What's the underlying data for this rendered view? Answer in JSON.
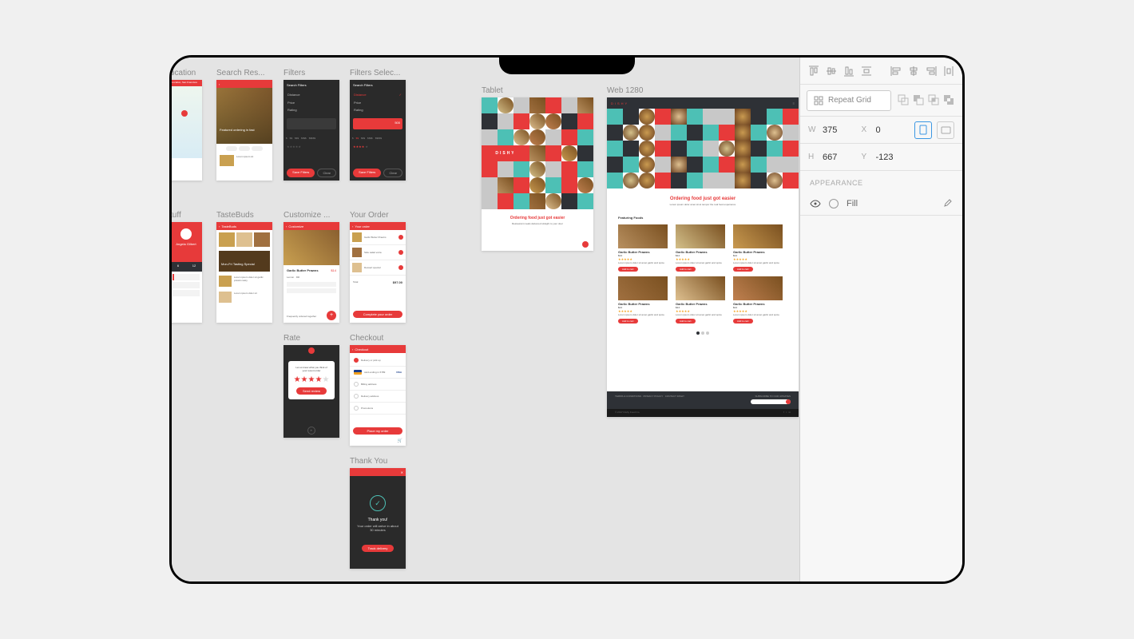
{
  "panel": {
    "repeat_label": "Repeat Grid",
    "w_label": "W",
    "w_value": "375",
    "h_label": "H",
    "h_value": "667",
    "x_label": "X",
    "x_value": "0",
    "y_label": "Y",
    "y_value": "-123",
    "appearance_head": "APPEARANCE",
    "fill_label": "Fill"
  },
  "mobile": {
    "row1": [
      "ocation",
      "Search Res...",
      "Filters",
      "Filters Selec..."
    ],
    "row2": [
      "tuff",
      "TasteBuds",
      "Customize ...",
      "Your Order"
    ],
    "row3": [
      "Rate",
      "Checkout"
    ],
    "row4": [
      "Thank You"
    ],
    "save_btn": "Save Filters",
    "clear_btn": "Clear",
    "filter_opts": [
      "Price",
      "Rating"
    ],
    "filter_opt_top": "Distance",
    "loc_text": "Location, San Francisco",
    "dish_title": "Garlic Butter Prawns",
    "dish_price": "$14",
    "complete_btn": "Complete your order",
    "order_total_label": "Total",
    "order_total": "$97.00",
    "rate_text": "Let us know what you think of your recent order",
    "rate_btn": "Send review",
    "thank_title": "Thank you!",
    "thank_body": "Your order will arrive in about 30 minutes",
    "thank_btn": "Track delivery",
    "checkout_head": "Checkout",
    "checkout_opts": [
      "Delivery or pick up",
      "card ending in 6789",
      "Billing address",
      "Delivery address",
      "Promotions"
    ],
    "checkout_btn": "Place my order",
    "tastebuds_head": "TasteBuds",
    "customize_head": "Customize",
    "yourorder_head": "Your order"
  },
  "tablet": {
    "label": "Tablet",
    "logo": "DISHY",
    "headline": "Ordering food just got easier",
    "sub": "Restaurant meals delivered straight to your door"
  },
  "web": {
    "label": "Web 1280",
    "logo": "DISHY",
    "headline": "Ordering food just got easier",
    "sub": "Lorem ipsum dolor amet sit at tempor the real food experience",
    "section": "Featuring Foods",
    "item_title": "Garlic Butter Prawns",
    "item_price": "$14",
    "item_btn": "Add to cart",
    "stars": "★★★★★",
    "footer1": "TERMS & CONDITIONS",
    "footer2": "PRIVACY POLICY",
    "footer3": "CONTACT DISHY",
    "footer_sub": "SUBSCRIBE TO OUR UPDATES"
  },
  "grid_colors": [
    "#4dc0b5",
    "#e73a3a",
    "#c8c8c8",
    "#2e3136",
    "#e73a3a",
    "#c8c8c8",
    "#4dc0b5",
    "#2e3136",
    "#c8c8c8",
    "#e73a3a",
    "#4dc0b5",
    "#c8c8c8",
    "#2e3136",
    "#e73a3a",
    "#c8c8c8",
    "#4dc0b5",
    "#e73a3a",
    "#2e3136",
    "#c8c8c8",
    "#e73a3a",
    "#4dc0b5",
    "#c8c8c8",
    "#e73a3a",
    "#2e3136"
  ],
  "food_colors": [
    "#b89060",
    "#d4c08a",
    "#c99a50",
    "#a07040",
    "#dec090",
    "#c08050"
  ]
}
